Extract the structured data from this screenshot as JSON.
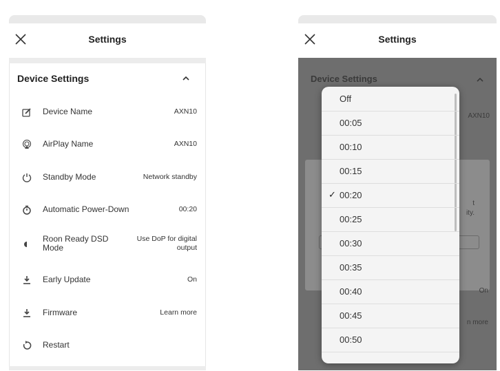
{
  "left_screen": {
    "title": "Settings",
    "section_title": "Device Settings",
    "rows": [
      {
        "label": "Device Name",
        "value": "AXN10",
        "icon": "edit-icon"
      },
      {
        "label": "AirPlay Name",
        "value": "AXN10",
        "icon": "airplay-icon"
      },
      {
        "label": "Standby Mode",
        "value": "Network standby",
        "icon": "power-icon"
      },
      {
        "label": "Automatic Power-Down",
        "value": "00:20",
        "icon": "timer-icon"
      },
      {
        "label": "Roon Ready DSD Mode",
        "value": "Use DoP for digital output",
        "icon": "dsd-icon"
      },
      {
        "label": "Early Update",
        "value": "On",
        "icon": "download-icon"
      },
      {
        "label": "Firmware",
        "value": "Learn more",
        "icon": "download-icon"
      },
      {
        "label": "Restart",
        "value": "",
        "icon": "restart-icon"
      }
    ]
  },
  "right_screen": {
    "title": "Settings",
    "background_section": "Device Settings",
    "background_fragments": [
      "AXN10",
      "t",
      "ity.",
      "On",
      "n more"
    ],
    "picker_options": [
      "Off",
      "00:05",
      "00:10",
      "00:15",
      "00:20",
      "00:25",
      "00:30",
      "00:35",
      "00:40",
      "00:45",
      "00:50"
    ],
    "selected_option": "00:20"
  }
}
